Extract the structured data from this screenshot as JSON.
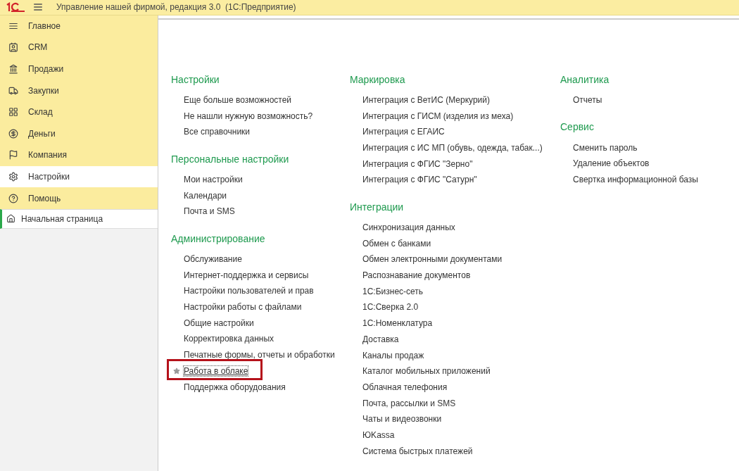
{
  "window": {
    "title": "Управление нашей фирмой, редакция 3.0  (1С:Предприятие)"
  },
  "sidebar": {
    "items": [
      {
        "label": "Главное",
        "selected": false
      },
      {
        "label": "CRM",
        "selected": false
      },
      {
        "label": "Продажи",
        "selected": false
      },
      {
        "label": "Закупки",
        "selected": false
      },
      {
        "label": "Склад",
        "selected": false
      },
      {
        "label": "Деньги",
        "selected": false
      },
      {
        "label": "Компания",
        "selected": false
      },
      {
        "label": "Настройки",
        "selected": true
      },
      {
        "label": "Помощь",
        "selected": false
      }
    ],
    "open_pages": [
      {
        "label": "Начальная страница",
        "selected": true
      }
    ]
  },
  "columns": [
    [
      {
        "title": "Настройки",
        "items": [
          {
            "label": "Еще больше возможностей"
          },
          {
            "label": "Не нашли нужную возможность?"
          },
          {
            "label": "Все справочники"
          }
        ]
      },
      {
        "title": "Персональные настройки",
        "items": [
          {
            "label": "Мои настройки"
          },
          {
            "label": "Календари"
          },
          {
            "label": "Почта и SMS"
          }
        ]
      },
      {
        "title": "Администрирование",
        "items": [
          {
            "label": "Обслуживание"
          },
          {
            "label": "Интернет-поддержка и сервисы"
          },
          {
            "label": "Настройки пользователей и прав"
          },
          {
            "label": "Настройки работы с файлами"
          },
          {
            "label": "Общие настройки"
          },
          {
            "label": "Корректировка данных"
          },
          {
            "label": "Печатные формы, отчеты и обработки"
          },
          {
            "label": "Работа в облаке",
            "starred": true,
            "highlighted": true
          },
          {
            "label": "Поддержка оборудования"
          }
        ]
      }
    ],
    [
      {
        "title": "Маркировка",
        "items": [
          {
            "label": "Интеграция с ВетИС (Меркурий)"
          },
          {
            "label": "Интеграция с ГИСМ (изделия из меха)"
          },
          {
            "label": "Интеграция с ЕГАИС"
          },
          {
            "label": "Интеграция с ИС МП (обувь, одежда, табак...)"
          },
          {
            "label": "Интеграция с ФГИС \"Зерно\""
          },
          {
            "label": "Интеграция с ФГИС \"Сатурн\""
          }
        ]
      },
      {
        "title": "Интеграции",
        "items": [
          {
            "label": "Синхронизация данных"
          },
          {
            "label": "Обмен с банками"
          },
          {
            "label": "Обмен электронными документами"
          },
          {
            "label": "Распознавание документов"
          },
          {
            "label": "1С:Бизнес-сеть"
          },
          {
            "label": "1С:Сверка 2.0"
          },
          {
            "label": "1С:Номенклатура"
          },
          {
            "label": "Доставка"
          },
          {
            "label": "Каналы продаж"
          },
          {
            "label": "Каталог мобильных приложений"
          },
          {
            "label": "Облачная телефония"
          },
          {
            "label": "Почта, рассылки и SMS"
          },
          {
            "label": "Чаты и видеозвонки"
          },
          {
            "label": "ЮKassa"
          },
          {
            "label": "Система быстрых платежей"
          }
        ]
      }
    ],
    [
      {
        "title": "Аналитика",
        "items": [
          {
            "label": "Отчеты"
          }
        ]
      },
      {
        "title": "Сервис",
        "items": [
          {
            "label": "Сменить пароль"
          },
          {
            "label": "Удаление объектов"
          },
          {
            "label": "Свертка информационной базы"
          }
        ]
      }
    ]
  ]
}
